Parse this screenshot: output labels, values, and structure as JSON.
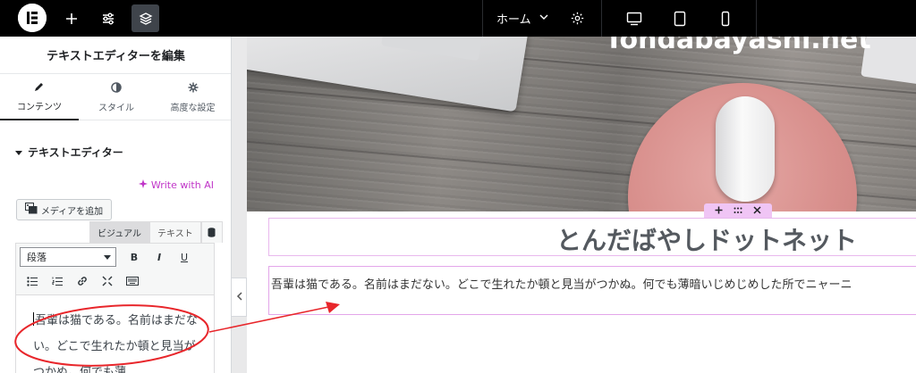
{
  "topbar": {
    "page_selector": "ホーム"
  },
  "panel": {
    "title": "テキストエディターを編集",
    "tabs": [
      {
        "label": "コンテンツ"
      },
      {
        "label": "スタイル"
      },
      {
        "label": "高度な設定"
      }
    ],
    "section_title": "テキストエディター",
    "ai_link": "Write with AI",
    "media_button": "メディアを追加",
    "mode_visual": "ビジュアル",
    "mode_text": "テキスト",
    "format_select": "段落",
    "editor_text": "吾輩は猫である。名前はまだない。どこで生れたか頓と見当がつかぬ。何でも薄"
  },
  "canvas": {
    "site_url": "Tondabayashi.net",
    "site_heading": "とんだばやしドットネット",
    "site_text": "吾輩は猫である。名前はまだない。どこで生れたか頓と見当がつかぬ。何でも薄暗いじめじめした所でニャーニ"
  },
  "colors": {
    "accent_ai": "#c036c8",
    "selection_border": "#e3a6ea",
    "annotation_red": "#e8262b"
  }
}
